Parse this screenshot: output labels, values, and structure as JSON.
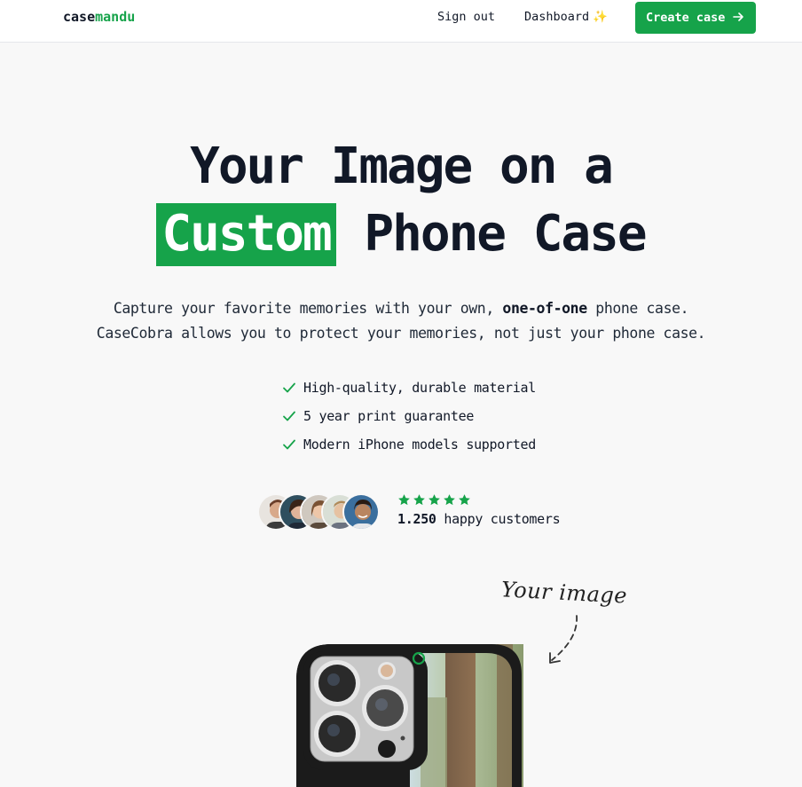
{
  "nav": {
    "logo_prefix": "case",
    "logo_accent": "mandu",
    "sign_out": "Sign out",
    "dashboard": "Dashboard",
    "dashboard_emoji": "✨",
    "cta_label": "Create case",
    "cta_icon": "arrow-right-icon"
  },
  "hero": {
    "title_line1": "Your Image on a",
    "title_highlight": "Custom",
    "title_line2_rest": "Phone Case",
    "sub_line1_pre": "Capture your favorite memories with your own,",
    "sub_line1_bold": "one-of-one",
    "sub_line1_post": "phone case.",
    "sub_line2": "CaseCobra allows you to protect your memories, not just your phone case."
  },
  "features": [
    "High-quality, durable material",
    "5 year print guarantee",
    "Modern iPhone models supported"
  ],
  "social_proof": {
    "rating_stars": 5,
    "customer_count": "1.250",
    "customer_label": "happy customers"
  },
  "annotation": {
    "your_image": "Your image"
  },
  "colors": {
    "accent": "#16a34a",
    "background": "#f8f8f8",
    "text": "#111827"
  }
}
